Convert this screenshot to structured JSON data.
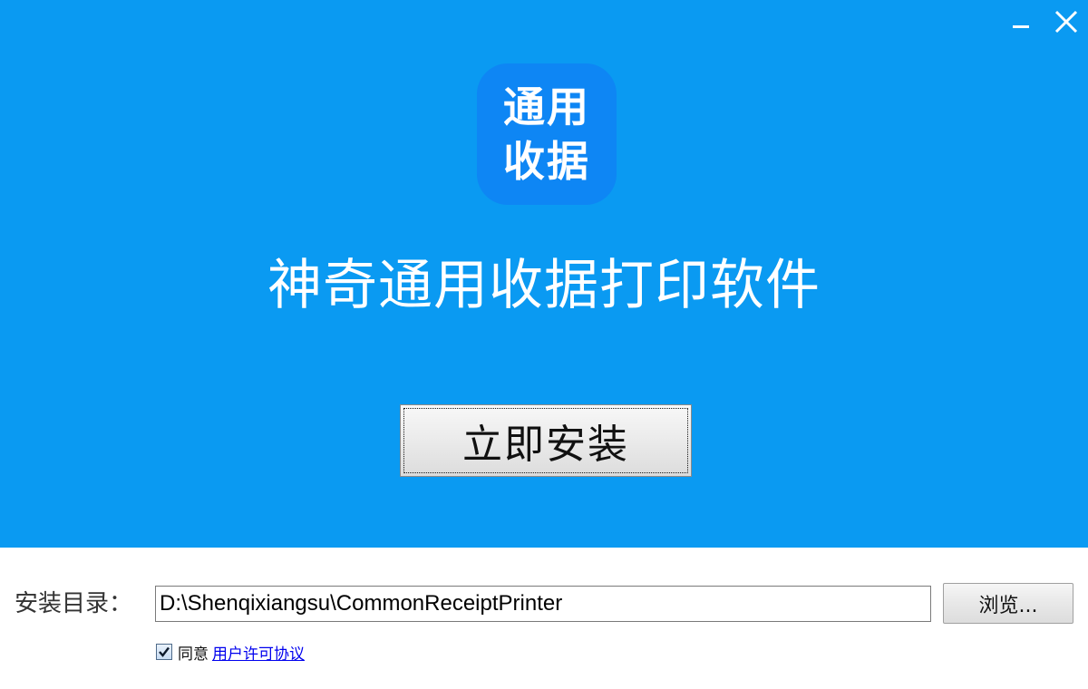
{
  "window": {
    "minimize_icon": "minimize-icon",
    "close_icon": "close-icon"
  },
  "logo": {
    "line1": "通用",
    "line2": "收据"
  },
  "app_title": "神奇通用收据打印软件",
  "install_button_label": "立即安装",
  "install_dir": {
    "label": "安装目录：",
    "value": "D:\\Shenqixiangsu\\CommonReceiptPrinter",
    "browse_label": "浏览..."
  },
  "agreement": {
    "checked": true,
    "text": "同意",
    "link": "用户许可协议"
  },
  "colors": {
    "hero_bg": "#0a9af2",
    "logo_bg": "#0e86f4",
    "link": "#0000ee"
  }
}
